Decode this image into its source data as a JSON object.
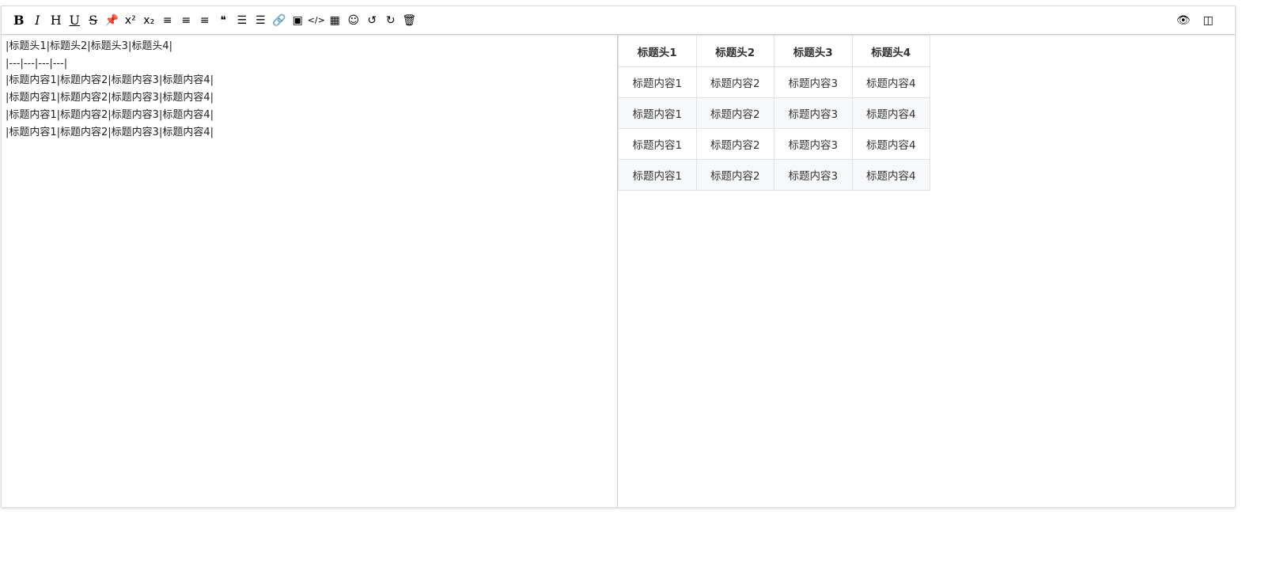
{
  "toolbar": {
    "items": [
      {
        "name": "bold",
        "glyph": "B"
      },
      {
        "name": "italic",
        "glyph": "I"
      },
      {
        "name": "header",
        "glyph": "H"
      },
      {
        "name": "underline",
        "glyph": "U"
      },
      {
        "name": "strikethrough",
        "glyph": "S"
      },
      {
        "name": "mark",
        "glyph": "📌"
      },
      {
        "name": "superscript",
        "glyph": "x²"
      },
      {
        "name": "subscript",
        "glyph": "x₂"
      },
      {
        "name": "align-left",
        "glyph": "≡"
      },
      {
        "name": "align-center",
        "glyph": "≡"
      },
      {
        "name": "align-right",
        "glyph": "≡"
      },
      {
        "name": "quote",
        "glyph": "❝"
      },
      {
        "name": "ordered-list",
        "glyph": "☰"
      },
      {
        "name": "unordered-list",
        "glyph": "☰"
      },
      {
        "name": "link",
        "glyph": "🔗"
      },
      {
        "name": "image",
        "glyph": "▣"
      },
      {
        "name": "code",
        "glyph": "</>"
      },
      {
        "name": "table",
        "glyph": "▦"
      },
      {
        "name": "emoji",
        "glyph": "☺"
      },
      {
        "name": "undo",
        "glyph": "↺"
      },
      {
        "name": "redo",
        "glyph": "↻"
      },
      {
        "name": "trash",
        "glyph": "🗑"
      }
    ],
    "right_items": [
      {
        "name": "preview-toggle",
        "glyph": "👁"
      },
      {
        "name": "split-view",
        "glyph": "◫"
      }
    ]
  },
  "source_lines": [
    "|标题头1|标题头2|标题头3|标题头4|",
    "|---|---|---|---|",
    "|标题内容1|标题内容2|标题内容3|标题内容4|",
    "|标题内容1|标题内容2|标题内容3|标题内容4|",
    "|标题内容1|标题内容2|标题内容3|标题内容4|",
    "|标题内容1|标题内容2|标题内容3|标题内容4|"
  ],
  "preview": {
    "headers": [
      "标题头1",
      "标题头2",
      "标题头3",
      "标题头4"
    ],
    "rows": [
      [
        "标题内容1",
        "标题内容2",
        "标题内容3",
        "标题内容4"
      ],
      [
        "标题内容1",
        "标题内容2",
        "标题内容3",
        "标题内容4"
      ],
      [
        "标题内容1",
        "标题内容2",
        "标题内容3",
        "标题内容4"
      ],
      [
        "标题内容1",
        "标题内容2",
        "标题内容3",
        "标题内容4"
      ]
    ]
  }
}
